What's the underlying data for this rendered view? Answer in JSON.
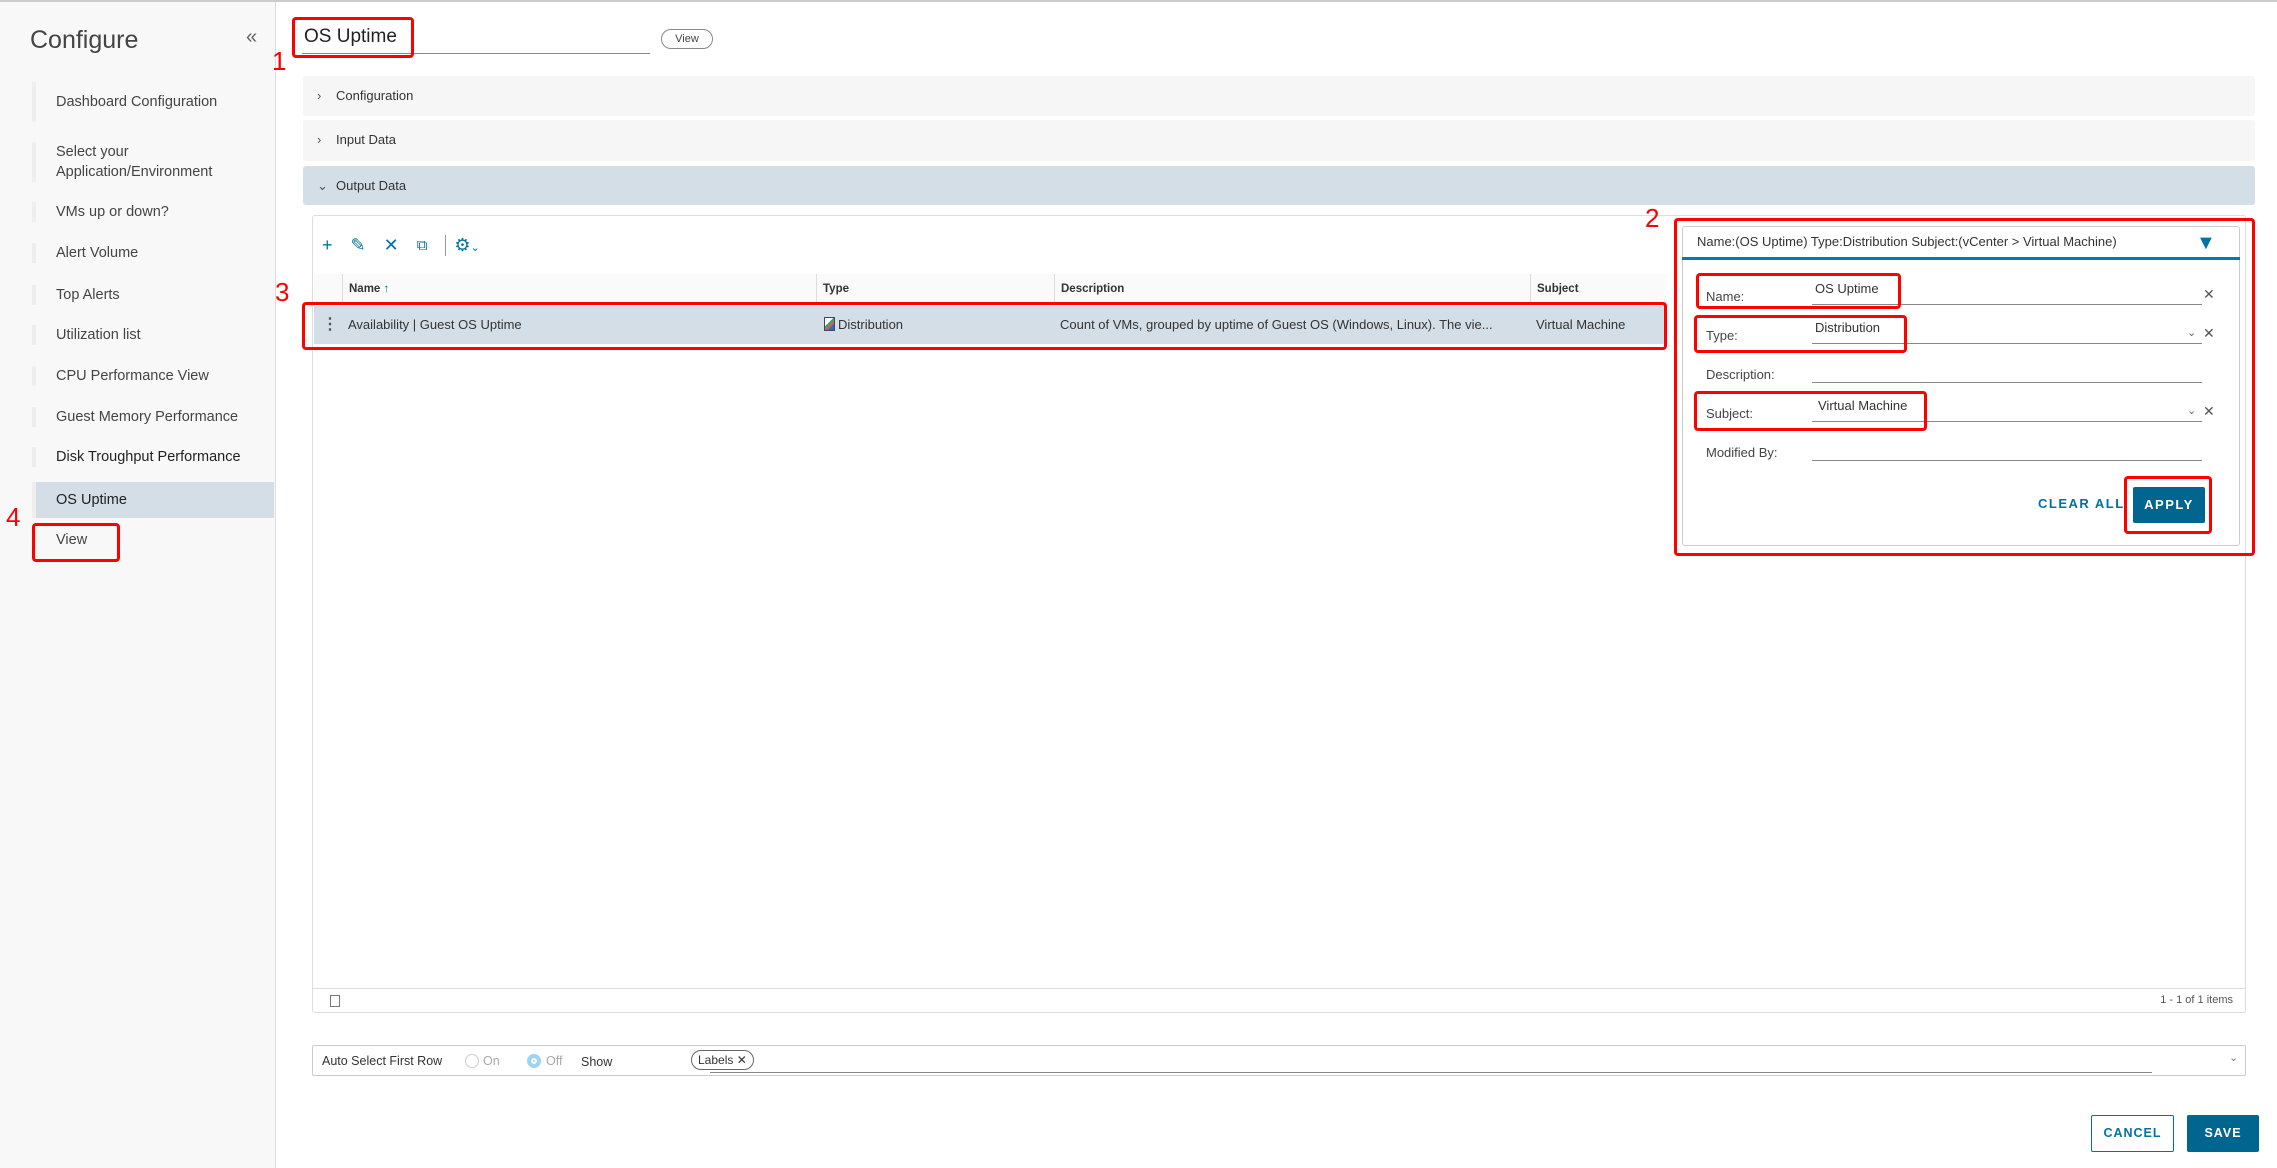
{
  "sidebar": {
    "title": "Configure",
    "collapse_icon": "«",
    "items": [
      {
        "label": "Dashboard Configuration"
      },
      {
        "label": "Select your Application/Environment"
      },
      {
        "label": "VMs up or down?"
      },
      {
        "label": "Alert Volume"
      },
      {
        "label": "Top Alerts"
      },
      {
        "label": "Utilization list"
      },
      {
        "label": "CPU Performance View"
      },
      {
        "label": "Guest Memory Performance"
      },
      {
        "label": "Disk Troughput Performance"
      },
      {
        "label": "OS Uptime",
        "active": true
      },
      {
        "label": "View"
      }
    ]
  },
  "header": {
    "title": "OS Uptime",
    "view_label": "View"
  },
  "accordions": [
    {
      "label": "Configuration"
    },
    {
      "label": "Input Data"
    },
    {
      "label": "Output Data",
      "open": true
    }
  ],
  "grid": {
    "columns": [
      "Name",
      "Type",
      "Description",
      "Subject"
    ],
    "rows": [
      {
        "name": "Availability | Guest OS Uptime",
        "type": "Distribution",
        "description": "Count of VMs, grouped by uptime of Guest OS (Windows, Linux). The vie...",
        "subject": "Virtual Machine"
      }
    ],
    "footer": "1 - 1 of 1 items"
  },
  "filter": {
    "summary": "Name:(OS Uptime)  Type:Distribution  Subject:(vCenter > Virtual Machine)",
    "fields": [
      {
        "label": "Name:",
        "value": "OS Uptime"
      },
      {
        "label": "Type:",
        "value": "Distribution"
      },
      {
        "label": "Description:",
        "value": ""
      },
      {
        "label": "Subject:",
        "value": "Virtual Machine"
      },
      {
        "label": "Modified By:",
        "value": ""
      }
    ],
    "clear_all": "CLEAR ALL",
    "apply": "APPLY"
  },
  "bottom": {
    "auto_select": "Auto Select First Row",
    "on": "On",
    "off": "Off",
    "selected": "Off",
    "show": "Show",
    "chip": "Labels"
  },
  "actions": {
    "cancel": "CANCEL",
    "save": "SAVE"
  },
  "annotations": [
    "1",
    "2",
    "3",
    "4"
  ],
  "colors": {
    "accent": "#0072a3",
    "primary_button": "#006690",
    "selected_row": "#d4dee6",
    "annotation": "#ff0000"
  }
}
